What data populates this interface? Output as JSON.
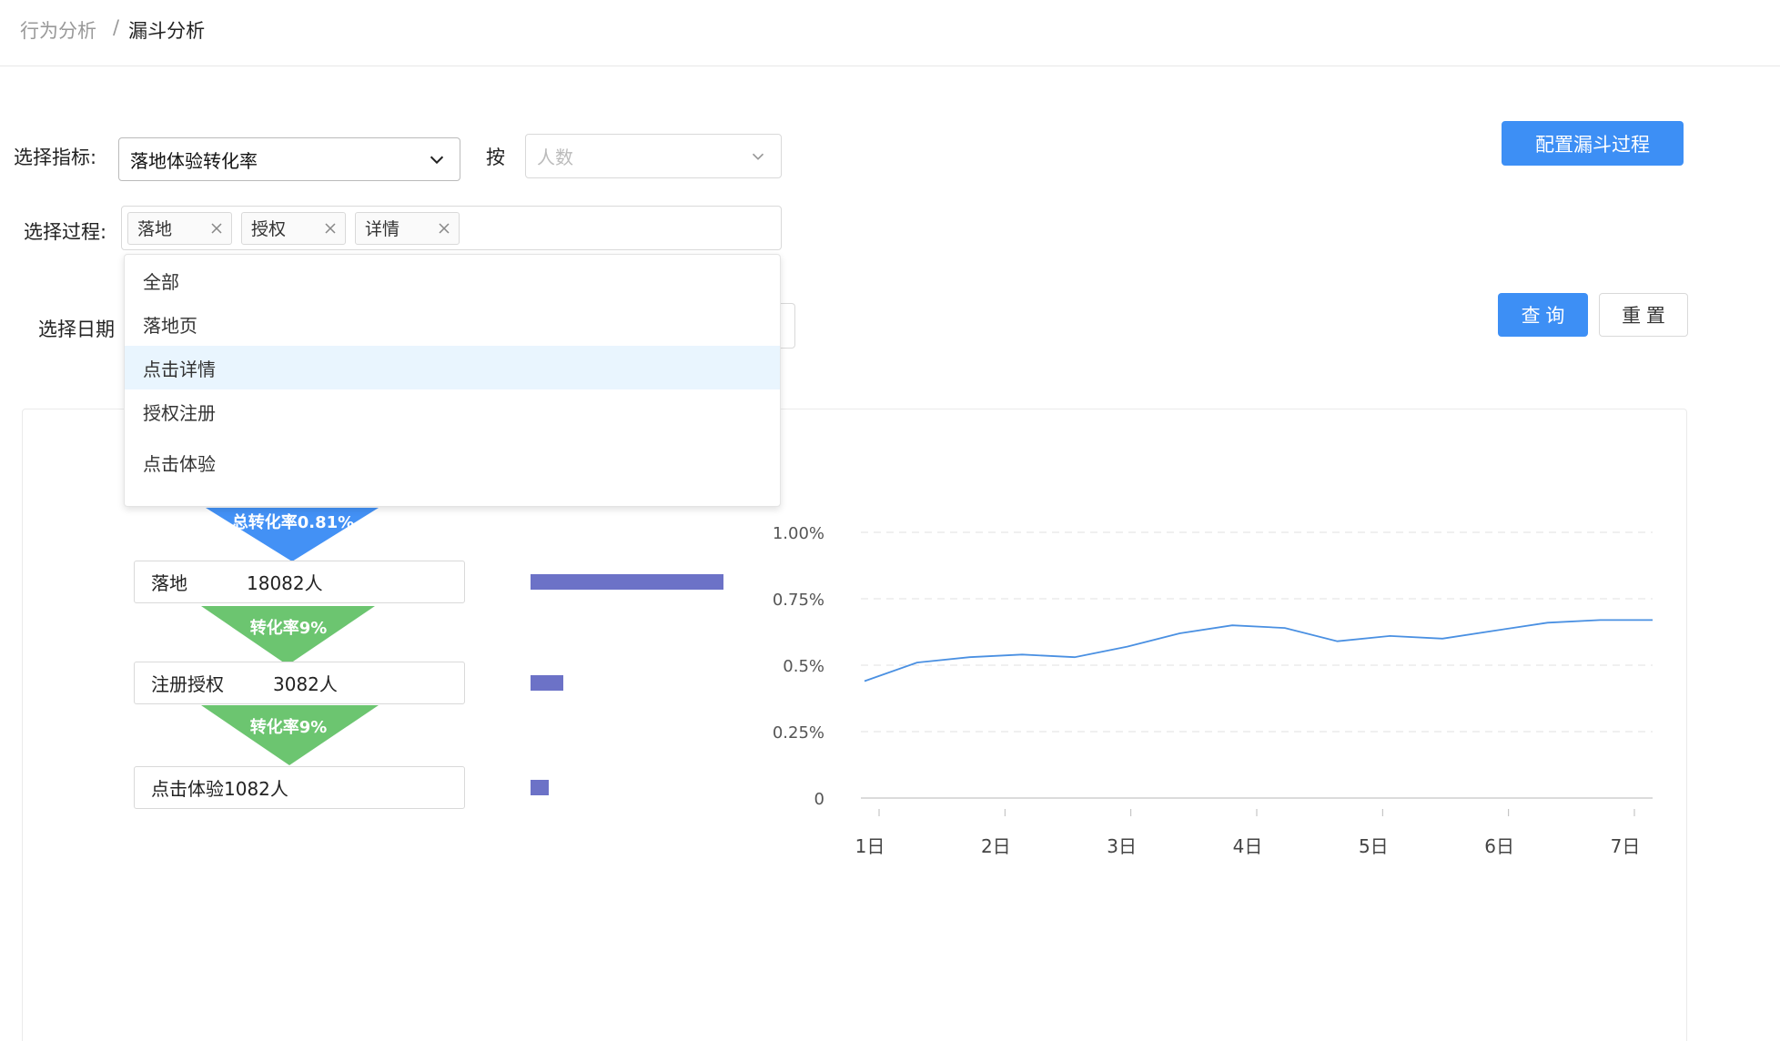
{
  "breadcrumb": {
    "parent": "行为分析",
    "separator": "/",
    "current": "漏斗分析"
  },
  "form": {
    "metric_label": "选择指标:",
    "metric_value": "落地体验转化率",
    "by_label": "按",
    "by_placeholder": "人数",
    "process_label": "选择过程:",
    "process_tags": [
      "落地",
      "授权",
      "详情"
    ],
    "date_label": "选择日期"
  },
  "dropdown": {
    "options": [
      "全部",
      "落地页",
      "点击详情",
      "授权注册",
      "点击体验"
    ],
    "highlighted": "点击详情"
  },
  "buttons": {
    "config": "配置漏斗过程",
    "query": "查 询",
    "reset": "重 置"
  },
  "funnel": {
    "total_rate": "总转化率0.81%",
    "steps": [
      {
        "name": "落地",
        "count": "18082人",
        "bar_value": 18082
      },
      {
        "name": "注册授权",
        "count": "3082人",
        "bar_value": 3082
      },
      {
        "name": "点击体验",
        "count": "1082人",
        "bar_value": 1082
      }
    ],
    "rates": [
      "转化率9%",
      "转化率9%"
    ],
    "colors": {
      "total": "#4391f5",
      "rate": "#6cc570",
      "bar": "#6c72c7"
    }
  },
  "chart_data": {
    "type": "line",
    "title": "",
    "xlabel": "",
    "ylabel": "",
    "ylim": [
      0,
      1.0
    ],
    "y_ticks": [
      0,
      0.25,
      0.5,
      0.75,
      1.0
    ],
    "y_tick_labels": [
      "0",
      "0.25%",
      "0.5%",
      "0.75%",
      "1.00%"
    ],
    "x_tick_labels": [
      "1日",
      "2日",
      "3日",
      "4日",
      "5日",
      "6日",
      "7日"
    ],
    "grid": true,
    "series": [
      {
        "color": "#4a90e2",
        "values": [
          0.44,
          0.51,
          0.53,
          0.54,
          0.53,
          0.57,
          0.62,
          0.65,
          0.64,
          0.59,
          0.61,
          0.6,
          0.63,
          0.66,
          0.67,
          0.67
        ]
      }
    ]
  }
}
